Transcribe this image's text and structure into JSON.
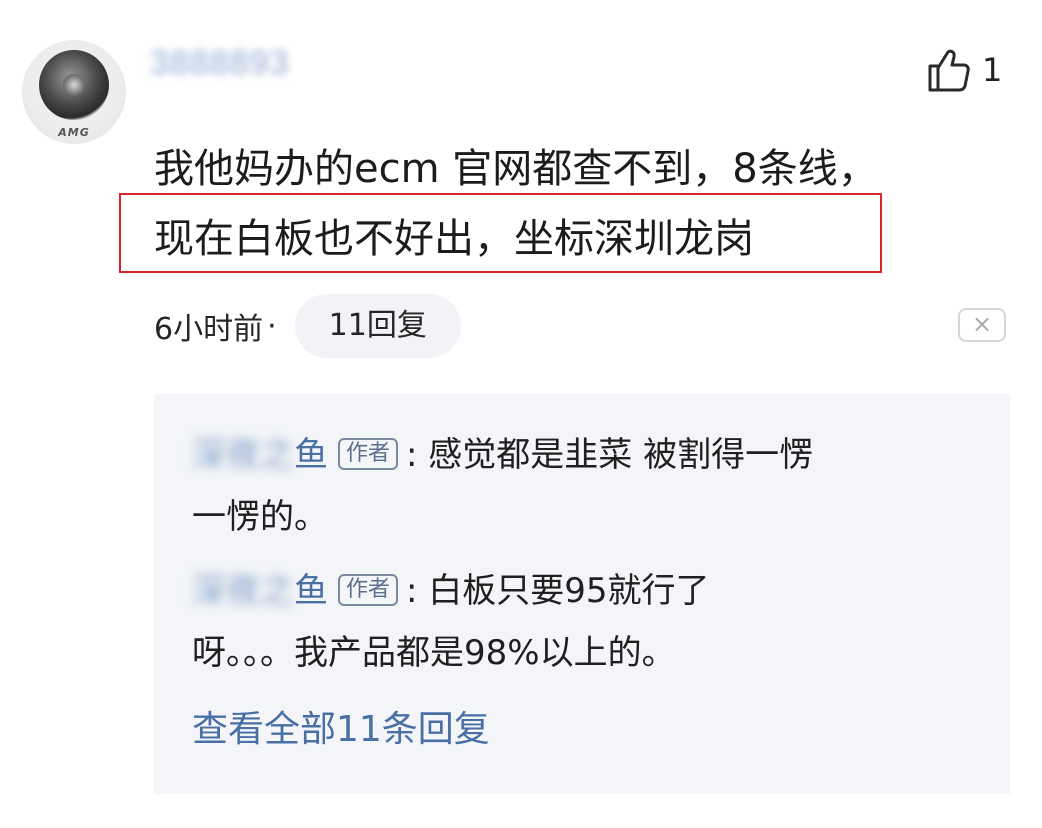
{
  "comment": {
    "avatar_brand": "AMG",
    "username": "3888893",
    "likes": "1",
    "text_line1": "我他妈办的ecm 官网都查不到，8条线，",
    "text_line2": "现在白板也不好出，坐标深圳龙岗",
    "time": "6小时前",
    "dot": "·",
    "reply_count_label": "11回复",
    "close_symbol": "×"
  },
  "replies": {
    "items": [
      {
        "author_blur": "深夜之",
        "author_visible": "鱼",
        "tag": "作者",
        "text_line1": ": 感觉都是韭菜 被割得一愣",
        "text_line2": "一愣的。"
      },
      {
        "author_blur": "深夜之",
        "author_visible": "鱼",
        "tag": "作者",
        "text_line1": ": 白板只要95就行了",
        "text_line2": "呀。。。我产品都是98%以上的。"
      }
    ],
    "view_all_label": "查看全部11条回复"
  },
  "colors": {
    "highlight_border": "#d9262b",
    "author_link": "#4a6fa5",
    "panel_bg": "#f3f5f8"
  },
  "icons": {
    "like": "thumbs-up-icon",
    "close": "close-icon"
  }
}
